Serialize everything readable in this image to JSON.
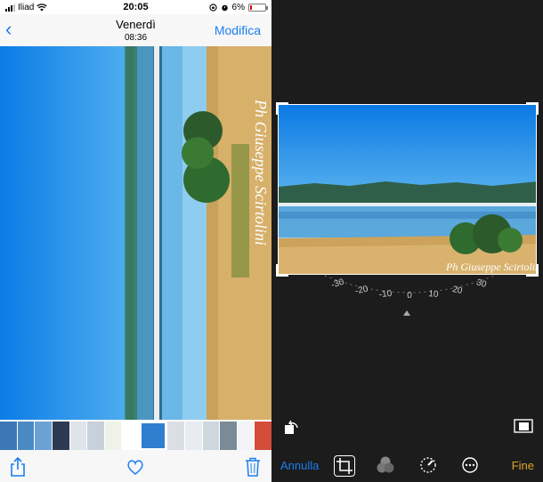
{
  "status_bar": {
    "carrier": "Iliad",
    "time": "20:05",
    "battery": "6%"
  },
  "nav": {
    "title": "Venerdì",
    "subtitle": "08:36",
    "edit_label": "Modifica"
  },
  "photo": {
    "watermark": "Ph Giuseppe Scirtolini"
  },
  "editor": {
    "dial_ticks": [
      "-30",
      "-20",
      "-10",
      "0",
      "10",
      "20",
      "30"
    ],
    "cancel_label": "Annulla",
    "done_label": "Fine"
  },
  "colors": {
    "accent_blue": "#1a7ef0",
    "done_yellow": "#e0a52a",
    "dark_bg": "#1c1c1c"
  },
  "icons": [
    "back-chevron-icon",
    "share-icon",
    "heart-icon",
    "trash-icon",
    "rotate-icon",
    "aspect-ratio-icon",
    "crop-icon",
    "filters-icon",
    "adjust-icon",
    "more-icon"
  ]
}
